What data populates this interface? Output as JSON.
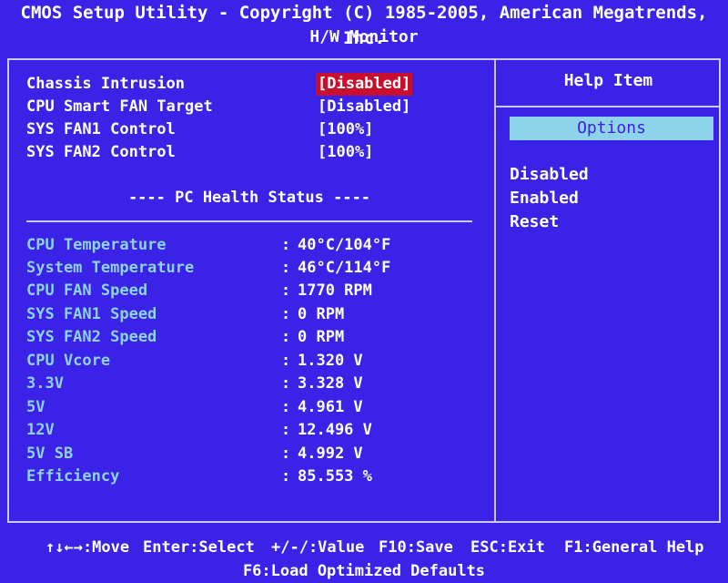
{
  "header": {
    "title": "CMOS Setup Utility - Copyright (C) 1985-2005, American Megatrends, Inc.",
    "subtitle": "H/W Monitor"
  },
  "settings": [
    {
      "label": "Chassis Intrusion",
      "value": "[Disabled]",
      "selected": true
    },
    {
      "label": "CPU Smart FAN Target",
      "value": "[Disabled]"
    },
    {
      "label": "SYS FAN1 Control",
      "value": "[100%]"
    },
    {
      "label": "SYS FAN2 Control",
      "value": "[100%]"
    }
  ],
  "health": {
    "section_title": "---- PC Health Status ----",
    "separator": ":",
    "rows": [
      {
        "label": "CPU Temperature",
        "value": "40°C/104°F"
      },
      {
        "label": "System Temperature",
        "value": "46°C/114°F"
      },
      {
        "label": "CPU FAN Speed",
        "value": "1770 RPM"
      },
      {
        "label": "SYS FAN1 Speed",
        "value": "0 RPM"
      },
      {
        "label": "SYS FAN2 Speed",
        "value": "0 RPM"
      },
      {
        "label": "CPU Vcore",
        "value": "1.320 V"
      },
      {
        "label": "3.3V",
        "value": "3.328 V"
      },
      {
        "label": "5V",
        "value": "4.961 V"
      },
      {
        "label": "12V",
        "value": "12.496 V"
      },
      {
        "label": "5V SB",
        "value": "4.992 V"
      },
      {
        "label": "Efficiency",
        "value": "85.553 %"
      }
    ]
  },
  "help": {
    "title": "Help Item",
    "options_label": "Options",
    "options": [
      "Disabled",
      "Enabled",
      "Reset"
    ]
  },
  "footer": {
    "move": "↑↓←→:Move",
    "select": "Enter:Select",
    "value": "+/-/:Value",
    "save": "F10:Save",
    "exit": "ESC:Exit",
    "help": "F1:General Help",
    "defaults": "F6:Load Optimized Defaults"
  },
  "colors": {
    "background": "#3a22e6",
    "highlight": "#c8102e",
    "label_cyan": "#8fd3ea",
    "border": "#c9c9f0"
  }
}
